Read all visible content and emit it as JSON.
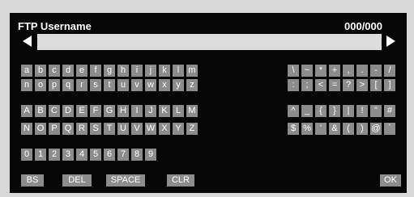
{
  "header": {
    "title": "FTP Username",
    "count": "000/000"
  },
  "input": {
    "value": ""
  },
  "keyboard": {
    "lower1": [
      "a",
      "b",
      "c",
      "d",
      "e",
      "f",
      "g",
      "h",
      "i",
      "j",
      "k",
      "l",
      "m"
    ],
    "lower2": [
      "n",
      "o",
      "p",
      "q",
      "r",
      "s",
      "t",
      "u",
      "v",
      "w",
      "x",
      "y",
      "z"
    ],
    "upper1": [
      "A",
      "B",
      "C",
      "D",
      "E",
      "F",
      "G",
      "H",
      "I",
      "J",
      "K",
      "L",
      "M"
    ],
    "upper2": [
      "N",
      "O",
      "P",
      "Q",
      "R",
      "S",
      "T",
      "U",
      "V",
      "W",
      "X",
      "Y",
      "Z"
    ],
    "digits": [
      "0",
      "1",
      "2",
      "3",
      "4",
      "5",
      "6",
      "7",
      "8",
      "9"
    ],
    "sym1": [
      "\\",
      "~",
      "*",
      "+",
      ",",
      ".",
      "-",
      "/"
    ],
    "sym2": [
      ":",
      ";",
      "<",
      "=",
      "?",
      ">",
      "[",
      "]"
    ],
    "sym3": [
      "^",
      "_",
      "{",
      "}",
      "|",
      "!",
      "\"",
      "#"
    ],
    "sym4": [
      "$",
      "%",
      "'",
      "&",
      "(",
      ")",
      "@",
      "`"
    ]
  },
  "functions": {
    "bs": "BS",
    "del": "DEL",
    "space": "SPACE",
    "clr": "CLR",
    "ok": "OK"
  }
}
